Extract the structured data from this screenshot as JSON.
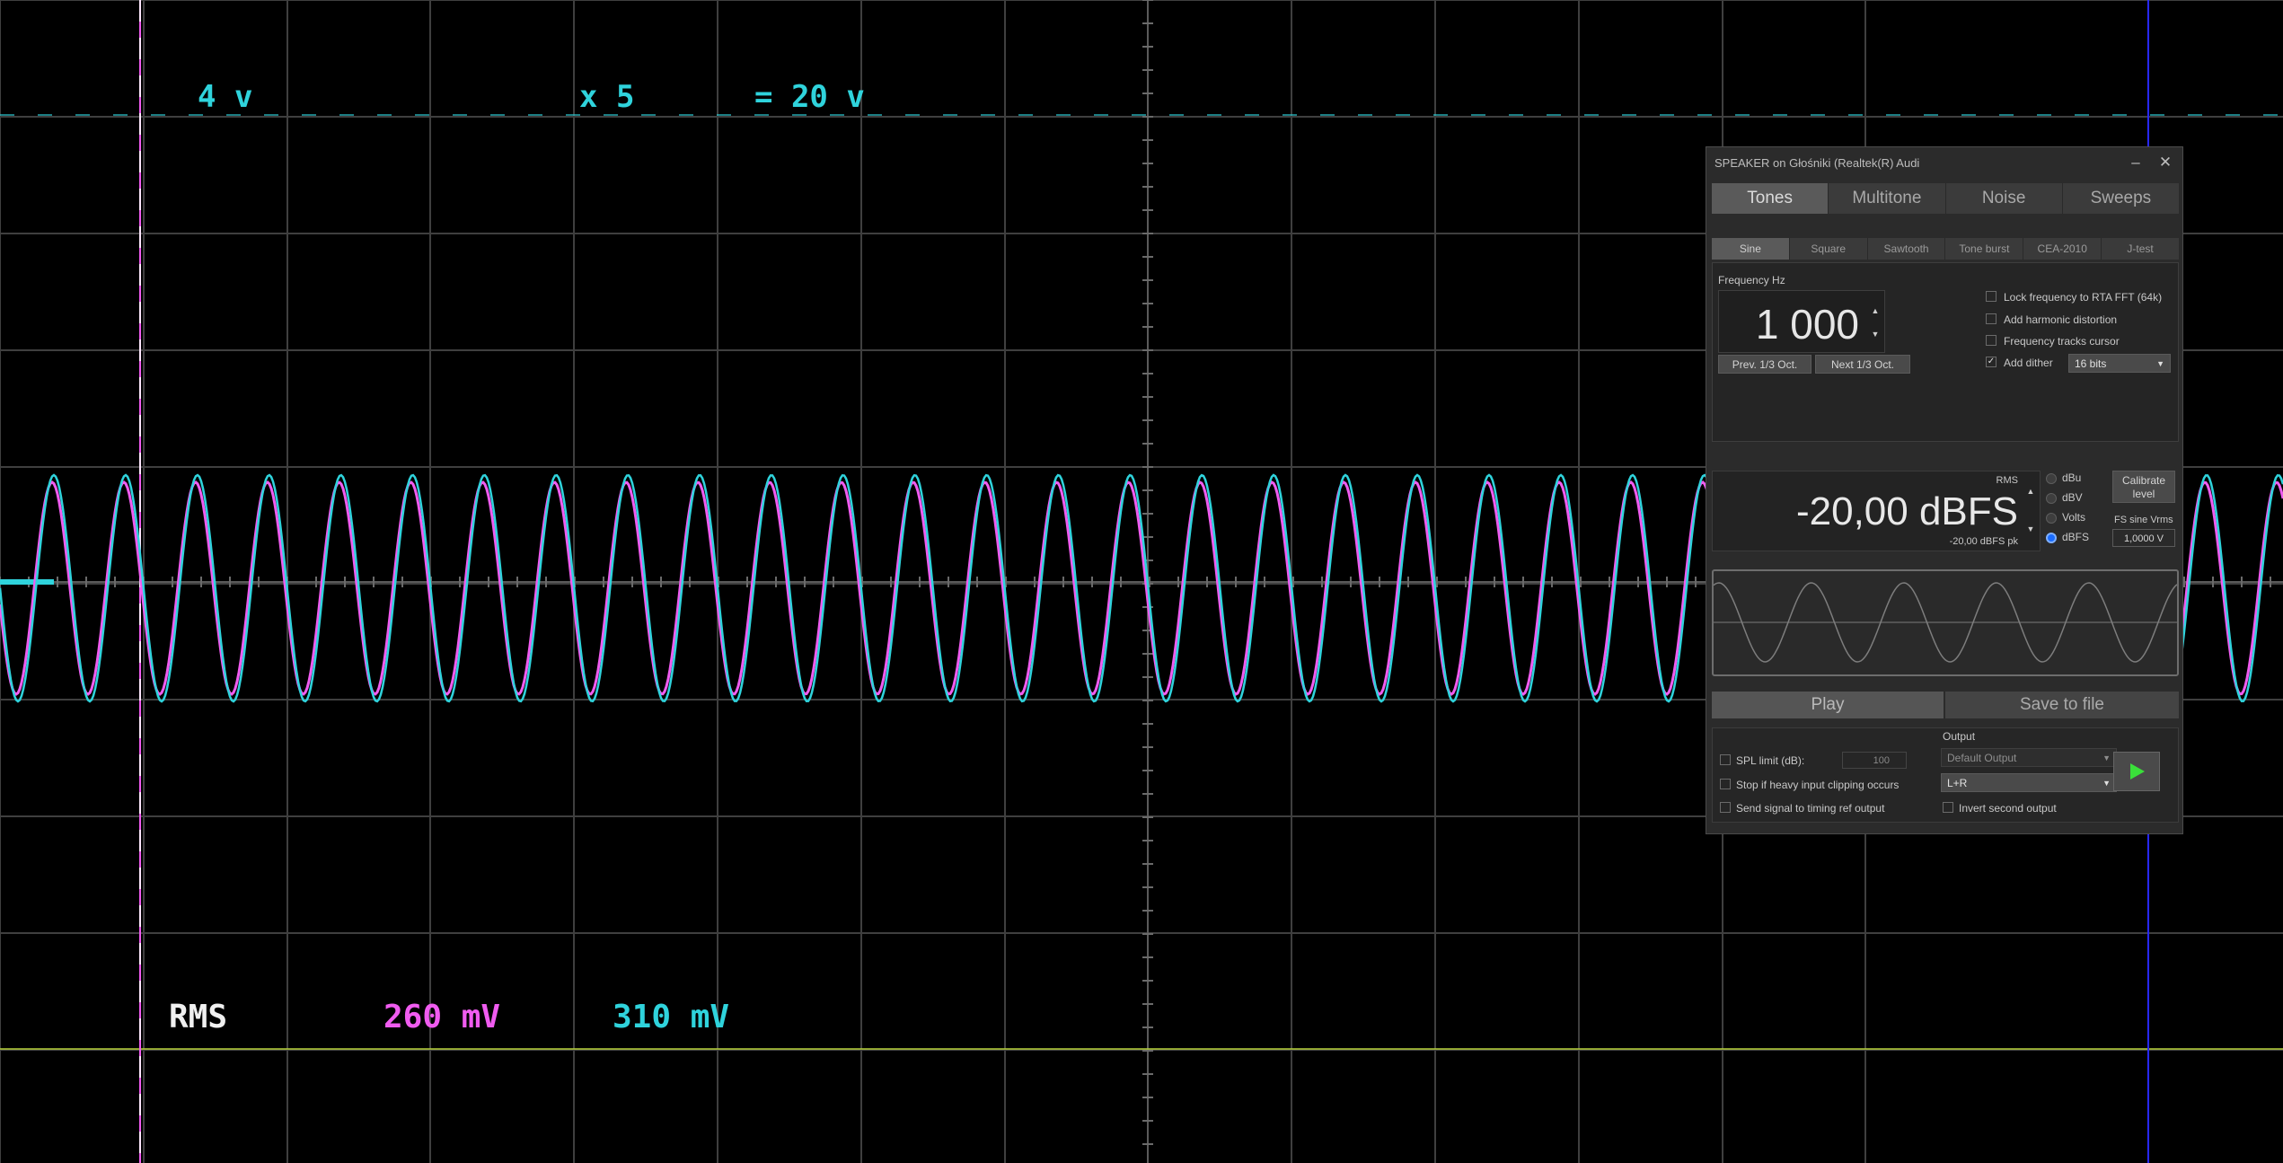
{
  "scope": {
    "volts_per_div": "4 v",
    "multiplier": "x 5",
    "range_result": "= 20 v",
    "rms_label": "RMS",
    "rms_channel_magenta": "260 mV",
    "rms_channel_cyan": "310 mV",
    "colors": {
      "cyan": "#2fd3dc",
      "magenta": "#f05cf0",
      "grid": "#404040",
      "trigger": "#cfe34a"
    }
  },
  "generator": {
    "title": "SPEAKER on Głośniki (Realtek(R) Audi",
    "main_tabs": [
      {
        "label": "Tones",
        "active": true
      },
      {
        "label": "Multitone",
        "active": false
      },
      {
        "label": "Noise",
        "active": false
      },
      {
        "label": "Sweeps",
        "active": false
      }
    ],
    "sub_tabs": [
      {
        "label": "Sine",
        "active": true
      },
      {
        "label": "Square",
        "active": false
      },
      {
        "label": "Sawtooth",
        "active": false
      },
      {
        "label": "Tone burst",
        "active": false
      },
      {
        "label": "CEA-2010",
        "active": false
      },
      {
        "label": "J-test",
        "active": false
      }
    ],
    "frequency_label": "Frequency Hz",
    "frequency_value": "1 000",
    "prev_btn": "Prev. 1/3 Oct.",
    "next_btn": "Next 1/3 Oct.",
    "options": [
      {
        "label": "Lock frequency to RTA FFT (64k)",
        "checked": false
      },
      {
        "label": "Add harmonic distortion",
        "checked": false
      },
      {
        "label": "Frequency tracks cursor",
        "checked": false
      },
      {
        "label": "Add dither",
        "checked": true
      }
    ],
    "dither_bits": "16 bits",
    "level": {
      "rms_label": "RMS",
      "value": "-20,00 dBFS",
      "peak": "-20,00 dBFS pk",
      "units": [
        {
          "label": "dBu",
          "selected": false
        },
        {
          "label": "dBV",
          "selected": false
        },
        {
          "label": "Volts",
          "selected": false
        },
        {
          "label": "dBFS",
          "selected": true
        }
      ],
      "calibrate_btn": "Calibrate level",
      "fs_sine_label": "FS sine Vrms",
      "fs_sine_value": "1,0000 V"
    },
    "play_btn": "Play",
    "save_btn": "Save to file",
    "output": {
      "label": "Output",
      "spl_limit_label": "SPL limit (dB):",
      "spl_limit_value": "100",
      "stop_clipping_label": "Stop if heavy input clipping occurs",
      "send_timing_label": "Send signal to timing ref output",
      "device": "Default Output",
      "channel": "L+R",
      "invert_label": "Invert second output"
    }
  }
}
